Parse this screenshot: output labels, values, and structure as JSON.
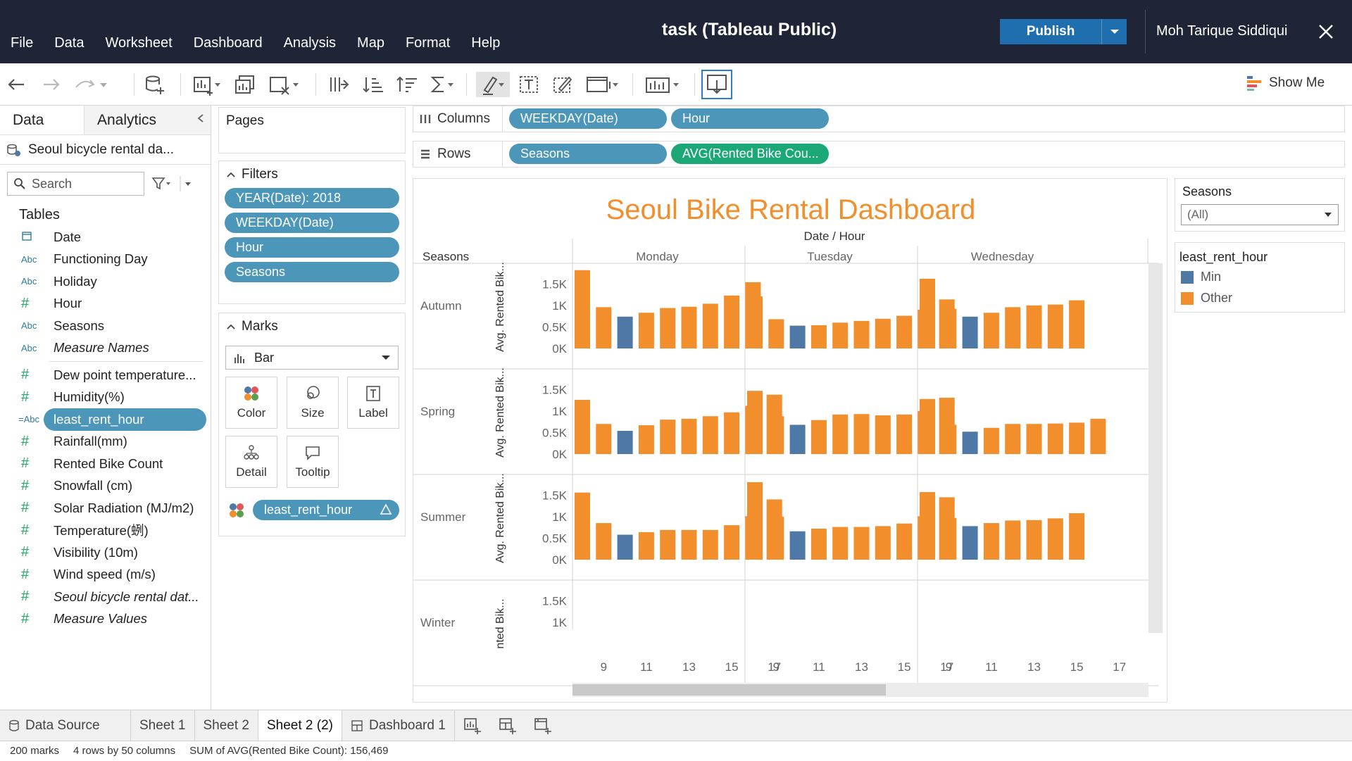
{
  "menu": [
    "File",
    "Data",
    "Worksheet",
    "Dashboard",
    "Analysis",
    "Map",
    "Format",
    "Help"
  ],
  "window_title": "task (Tableau Public)",
  "publish_label": "Publish",
  "user_name": "Moh Tarique Siddiqui",
  "show_me_label": "Show Me",
  "data_pane": {
    "tab_data": "Data",
    "tab_analytics": "Analytics",
    "datasource": "Seoul bicycle rental da...",
    "search_placeholder": "Search",
    "tables_heading": "Tables",
    "fields_dims": [
      {
        "icon": "calendar",
        "name": "Date"
      },
      {
        "icon": "Abc",
        "name": "Functioning Day"
      },
      {
        "icon": "Abc",
        "name": "Holiday"
      },
      {
        "icon": "#",
        "name": "Hour"
      },
      {
        "icon": "Abc",
        "name": "Seasons"
      },
      {
        "icon": "Abc",
        "name": "Measure Names",
        "italic": true
      }
    ],
    "fields_measures": [
      {
        "icon": "#",
        "name": "Dew point temperature..."
      },
      {
        "icon": "#",
        "name": "Humidity(%)"
      },
      {
        "icon": "=Abc",
        "name": "least_rent_hour",
        "selected": true
      },
      {
        "icon": "#",
        "name": "Rainfall(mm)"
      },
      {
        "icon": "#",
        "name": "Rented Bike Count"
      },
      {
        "icon": "#",
        "name": "Snowfall (cm)"
      },
      {
        "icon": "#",
        "name": "Solar Radiation (MJ/m2)"
      },
      {
        "icon": "#",
        "name": "Temperature(蛚)"
      },
      {
        "icon": "#",
        "name": "Visibility (10m)"
      },
      {
        "icon": "#",
        "name": "Wind speed (m/s)"
      },
      {
        "icon": "#",
        "name": "Seoul bicycle rental dat...",
        "italic": true
      },
      {
        "icon": "#",
        "name": "Measure Values",
        "italic": true
      }
    ]
  },
  "pages_label": "Pages",
  "filters": {
    "label": "Filters",
    "items": [
      "YEAR(Date): 2018",
      "WEEKDAY(Date)",
      "Hour",
      "Seasons"
    ]
  },
  "marks": {
    "label": "Marks",
    "type": "Bar",
    "buttons": [
      "Color",
      "Size",
      "Label",
      "Detail",
      "Tooltip"
    ],
    "color_field": "least_rent_hour"
  },
  "shelves": {
    "columns_label": "Columns",
    "columns": [
      "WEEKDAY(Date)",
      "Hour"
    ],
    "rows_label": "Rows",
    "rows": [
      "Seasons",
      "AVG(Rented Bike Cou..."
    ]
  },
  "viz": {
    "title": "Seoul Bike Rental Dashboard",
    "column_header": "Date / Hour",
    "row_header": "Seasons",
    "y_axis_label": "Avg. Rented Bik...",
    "y_axis_label_clipped": "nted Bik..."
  },
  "chart_data": {
    "type": "bar",
    "title": "Seoul Bike Rental Dashboard",
    "column_header": "Date / Hour",
    "row_header": "Seasons",
    "ylabel": "Avg. Rented Bike Count",
    "y_ticks": [
      "0K",
      "0.5K",
      "1K",
      "1.5K"
    ],
    "ylim": [
      0,
      1800
    ],
    "weekdays": [
      "Monday",
      "Tuesday",
      "Wednesday"
    ],
    "hours": [
      8,
      9,
      10,
      11,
      12,
      13,
      14,
      15,
      16,
      17
    ],
    "x_tick_labels": [
      "9",
      "11",
      "13",
      "15",
      "17"
    ],
    "color_legend": {
      "title": "least_rent_hour",
      "items": [
        {
          "name": "Min",
          "color": "#4e79a7"
        },
        {
          "name": "Other",
          "color": "#f28e2b"
        }
      ]
    },
    "min_hour_index": 2,
    "panels": [
      {
        "season": "Autumn",
        "days": [
          [
            1820,
            960,
            740,
            830,
            940,
            970,
            1040,
            1230,
            1540
          ],
          [
            1210,
            680,
            530,
            540,
            600,
            640,
            690,
            760,
            900,
            1140
          ],
          [
            1620,
            920,
            740,
            830,
            960,
            1000,
            1020,
            1120
          ]
        ]
      },
      {
        "season": "Spring",
        "days": [
          [
            1260,
            700,
            540,
            670,
            800,
            820,
            880,
            970,
            1120,
            1380
          ],
          [
            1470,
            880,
            680,
            790,
            920,
            930,
            900,
            920,
            1000,
            1310
          ],
          [
            1280,
            680,
            520,
            610,
            700,
            700,
            710,
            730,
            820
          ]
        ]
      },
      {
        "season": "Summer",
        "days": [
          [
            1560,
            850,
            580,
            640,
            690,
            690,
            690,
            800,
            1010,
            1400
          ],
          [
            1800,
            1000,
            660,
            720,
            760,
            760,
            780,
            840,
            1010,
            1450
          ],
          [
            1570,
            970,
            780,
            850,
            910,
            920,
            960,
            1080
          ]
        ]
      },
      {
        "season": "Winter",
        "days": [
          [],
          [],
          []
        ]
      }
    ]
  },
  "legend_seasons": {
    "title": "Seasons",
    "value": "(All)"
  },
  "sheet_tabs": [
    "Data Source",
    "Sheet 1",
    "Sheet 2",
    "Sheet 2 (2)",
    "Dashboard 1"
  ],
  "status": {
    "marks": "200 marks",
    "dims": "4 rows by 50 columns",
    "sum": "SUM of AVG(Rented Bike Count): 156,469"
  }
}
